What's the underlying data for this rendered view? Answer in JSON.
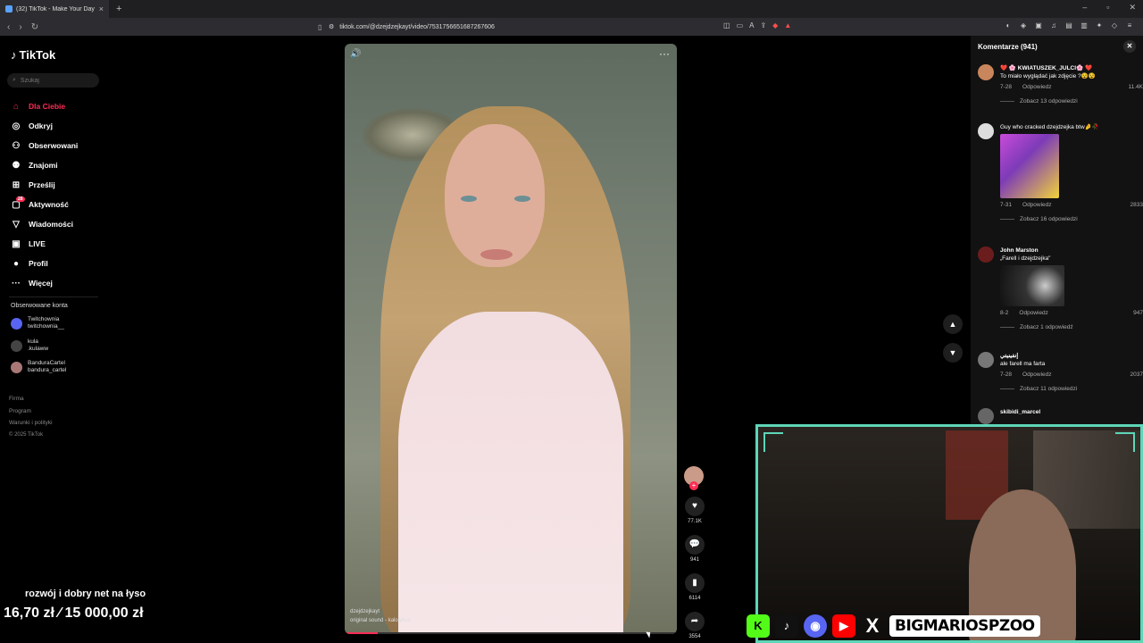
{
  "browser": {
    "tab_title": "(32) TikTok - Make Your Day",
    "url": "tiktok.com/@dzejdzejkayt/video/7531756651687267606"
  },
  "sidebar": {
    "logo": "TikTok",
    "search_placeholder": "Szukaj",
    "items": [
      {
        "label": "Dla Ciebie",
        "icon": "home-icon"
      },
      {
        "label": "Odkryj",
        "icon": "compass-icon"
      },
      {
        "label": "Obserwowani",
        "icon": "following-icon"
      },
      {
        "label": "Znajomi",
        "icon": "friends-icon"
      },
      {
        "label": "Prześlij",
        "icon": "upload-icon"
      },
      {
        "label": "Aktywność",
        "icon": "activity-icon",
        "badge": "28"
      },
      {
        "label": "Wiadomości",
        "icon": "messages-icon"
      },
      {
        "label": "LIVE",
        "icon": "live-icon"
      },
      {
        "label": "Profil",
        "icon": "profile-icon"
      },
      {
        "label": "Więcej",
        "icon": "more-icon"
      }
    ],
    "following_title": "Obserwowane konta",
    "accounts": [
      {
        "name": "Twitchownia",
        "handle": "twitchownia__"
      },
      {
        "name": "kula",
        "handle": ".kulaww"
      },
      {
        "name": "BanduraCartel",
        "handle": "bandura_cartel"
      }
    ],
    "footer": [
      "Firma",
      "Program",
      "Warunki i polityki"
    ],
    "copyright": "© 2025 TikTok"
  },
  "video": {
    "author": "dzejdzejkayt",
    "sound": "original sound - kalolyrics",
    "progress": 0.1
  },
  "actions": {
    "likes": "77.1K",
    "comments": "941",
    "saves": "6114",
    "shares": "3554"
  },
  "comments_panel": {
    "title": "Komentarze (941)",
    "reply_label": "Odpowiedz",
    "items": [
      {
        "user": "❤️ 🌸 KWIATUSZEK_JULCI🌸 ❤️",
        "text": "To miało wyglądać jak zdjęcie ?😵😵",
        "date": "7-28",
        "likes": "11.4K",
        "replies": "Zobacz 13 odpowiedzi"
      },
      {
        "user": "",
        "text": "Guy who cracked dzejdzejka btw🤌🥀",
        "date": "7-31",
        "likes": "2833",
        "replies": "Zobacz 16 odpowiedzi"
      },
      {
        "user": "John Marston",
        "text": "„Farell i dzejdzejka\"",
        "date": "8-2",
        "likes": "947",
        "replies": "Zobacz 1 odpowiedź"
      },
      {
        "user": "إنفينيتي",
        "text": "ale farell ma farta",
        "date": "7-28",
        "likes": "2037",
        "replies": "Zobacz 11 odpowiedzi"
      },
      {
        "user": "skibidi_marcel",
        "text": "",
        "date": "",
        "likes": "",
        "replies": ""
      }
    ]
  },
  "stream": {
    "donation_title": "rozwój i dobry net na łyso",
    "donation_amount": "16,70 zł ⁄ 15 000,00 zł",
    "handle": "BIGMARIOSPZOO",
    "socials": [
      "K",
      "♪",
      "◉",
      "▶",
      "X"
    ]
  },
  "colors": {
    "accent": "#fe2c55",
    "cam_border": "#5ed6b8"
  }
}
